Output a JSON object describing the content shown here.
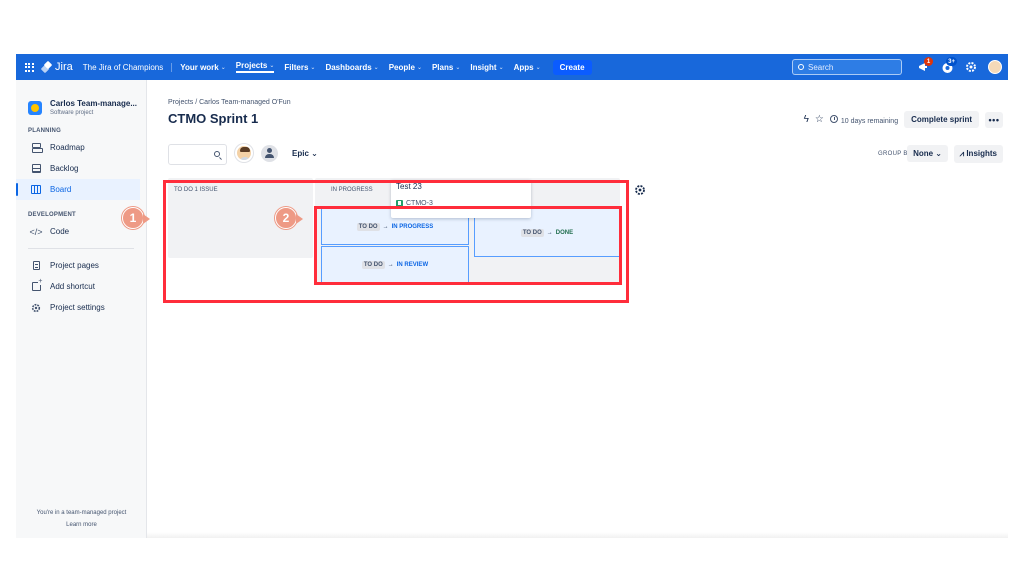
{
  "topnav": {
    "logo_text": "Jira",
    "site_title": "The Jira of Champions",
    "items": [
      {
        "label": "Your work",
        "dropdown": true
      },
      {
        "label": "Projects",
        "dropdown": true
      },
      {
        "label": "Filters",
        "dropdown": true
      },
      {
        "label": "Dashboards",
        "dropdown": true
      },
      {
        "label": "People",
        "dropdown": true
      },
      {
        "label": "Plans",
        "dropdown": true
      },
      {
        "label": "Insight",
        "dropdown": true
      },
      {
        "label": "Apps",
        "dropdown": true
      }
    ],
    "create_label": "Create",
    "search_placeholder": "Search",
    "notifications_badge": "1",
    "help_badge": "3+",
    "accent": "#1868db"
  },
  "sidebar": {
    "project_name": "Carlos Team-manage...",
    "project_type": "Software project",
    "section_planning": "PLANNING",
    "planning_items": [
      {
        "label": "Roadmap",
        "icon": "roadmap-icon"
      },
      {
        "label": "Backlog",
        "icon": "backlog-icon"
      },
      {
        "label": "Board",
        "icon": "board-icon",
        "active": true
      }
    ],
    "section_development": "DEVELOPMENT",
    "development_items": [
      {
        "label": "Code",
        "icon": "code-icon"
      }
    ],
    "other_items": [
      {
        "label": "Project pages",
        "icon": "page-icon"
      },
      {
        "label": "Add shortcut",
        "icon": "add-shortcut-icon"
      },
      {
        "label": "Project settings",
        "icon": "gear-icon"
      }
    ],
    "footer_text": "You're in a team-managed project",
    "footer_link": "Learn more"
  },
  "header": {
    "breadcrumb": "Projects  /  Carlos Team-managed O'Fun",
    "title": "CTMO Sprint 1",
    "days_remaining": "10 days remaining",
    "complete_sprint": "Complete sprint",
    "more": "•••"
  },
  "filters": {
    "epic_label": "Epic",
    "group_by_label": "GROUP BY",
    "group_by_value": "None",
    "insights_label": "Insights"
  },
  "board": {
    "columns": [
      {
        "header": "TO DO 1 ISSUE"
      },
      {
        "header": "IN PROGRESS"
      }
    ],
    "transitions": [
      {
        "from": "TO DO",
        "to": "IN PROGRESS"
      },
      {
        "from": "TO DO",
        "to": "IN REVIEW"
      },
      {
        "from": "TO DO",
        "to": "DONE"
      }
    ],
    "dragged_card": {
      "title": "Test 23",
      "key": "CTMO-3"
    }
  },
  "annotations": {
    "marker_1": "1",
    "marker_2": "2",
    "highlight_color": "#ff2d3b"
  }
}
